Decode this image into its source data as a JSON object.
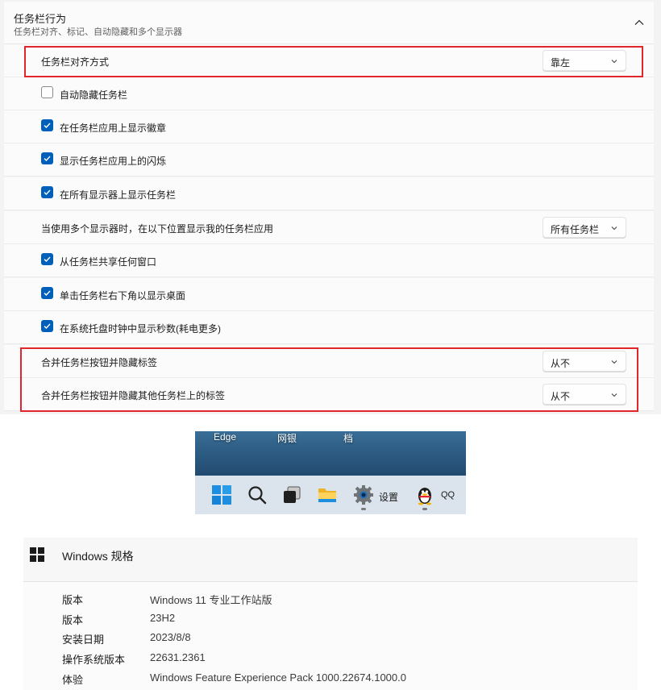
{
  "taskbar_behavior": {
    "title": "任务栏行为",
    "subtitle": "任务栏对齐、标记、自动隐藏和多个显示器",
    "rows": [
      {
        "label": "任务栏对齐方式",
        "dropdown": "靠左"
      },
      {
        "label": "自动隐藏任务栏",
        "checked": false
      },
      {
        "label": "在任务栏应用上显示徽章",
        "checked": true
      },
      {
        "label": "显示任务栏应用上的闪烁",
        "checked": true
      },
      {
        "label": "在所有显示器上显示任务栏",
        "checked": true
      },
      {
        "label": "当使用多个显示器时，在以下位置显示我的任务栏应用",
        "dropdown": "所有任务栏"
      },
      {
        "label": "从任务栏共享任何窗口",
        "checked": true
      },
      {
        "label": "单击任务栏右下角以显示桌面",
        "checked": true
      },
      {
        "label": "在系统托盘时钟中显示秒数(耗电更多)",
        "checked": true
      },
      {
        "label": "合并任务栏按钮并隐藏标签",
        "dropdown": "从不"
      },
      {
        "label": "合并任务栏按钮并隐藏其他任务栏上的标签",
        "dropdown": "从不"
      }
    ]
  },
  "taskbar_preview": {
    "desktop_labels": [
      "Edge",
      "网银",
      "档"
    ],
    "settings_label": "设置",
    "qq_label": "QQ",
    "icons": [
      "windows-start-icon",
      "search-icon",
      "task-view-icon",
      "file-explorer-icon",
      "settings-gear-icon",
      "qq-penguin-icon"
    ]
  },
  "windows_spec": {
    "title": "Windows 规格",
    "items": [
      {
        "key": "版本",
        "value": "Windows 11 专业工作站版"
      },
      {
        "key": "版本",
        "value": "23H2"
      },
      {
        "key": "安装日期",
        "value": "2023/8/8"
      },
      {
        "key": "操作系统版本",
        "value": "22631.2361"
      },
      {
        "key": "体验",
        "value": "Windows Feature Experience Pack 1000.22674.1000.0"
      }
    ]
  },
  "colors": {
    "accent": "#005fb8",
    "highlight_box": "#e0252b",
    "panel_bg": "#f3f3f3",
    "row_bg": "#fbfbfb"
  }
}
